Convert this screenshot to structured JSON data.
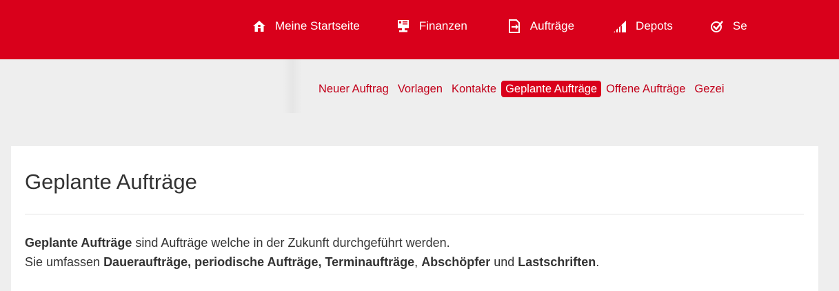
{
  "topnav": {
    "items": [
      {
        "label": "Meine Startseite",
        "icon": "home-icon"
      },
      {
        "label": "Finanzen",
        "icon": "monitor-icon"
      },
      {
        "label": "Aufträge",
        "icon": "document-arrow-icon"
      },
      {
        "label": "Depots",
        "icon": "bar-chart-icon"
      },
      {
        "label": "Se",
        "icon": "check-circle-icon"
      }
    ]
  },
  "subnav": {
    "items": [
      {
        "label": "Neuer Auftrag"
      },
      {
        "label": "Vorlagen"
      },
      {
        "label": "Kontakte"
      },
      {
        "label": "Geplante Aufträge",
        "active": true
      },
      {
        "label": "Offene Aufträge"
      },
      {
        "label": "Gezei"
      }
    ]
  },
  "main": {
    "title": "Geplante Aufträge",
    "line1": {
      "bold": "Geplante Aufträge",
      "rest": " sind Aufträge welche in der Zukunft durchgeführt werden."
    },
    "line2": {
      "prefix": "Sie umfassen ",
      "bold1": "Daueraufträge, periodische Aufträge, Terminaufträge",
      "sep1": ", ",
      "bold2": "Abschöpfer",
      "sep2": " und ",
      "bold3": "Lastschriften",
      "end": "."
    }
  },
  "colors": {
    "brand_red": "#d9001b",
    "link_red": "#c2001a",
    "background": "#eeeeee",
    "card": "#ffffff",
    "text": "#333333"
  }
}
